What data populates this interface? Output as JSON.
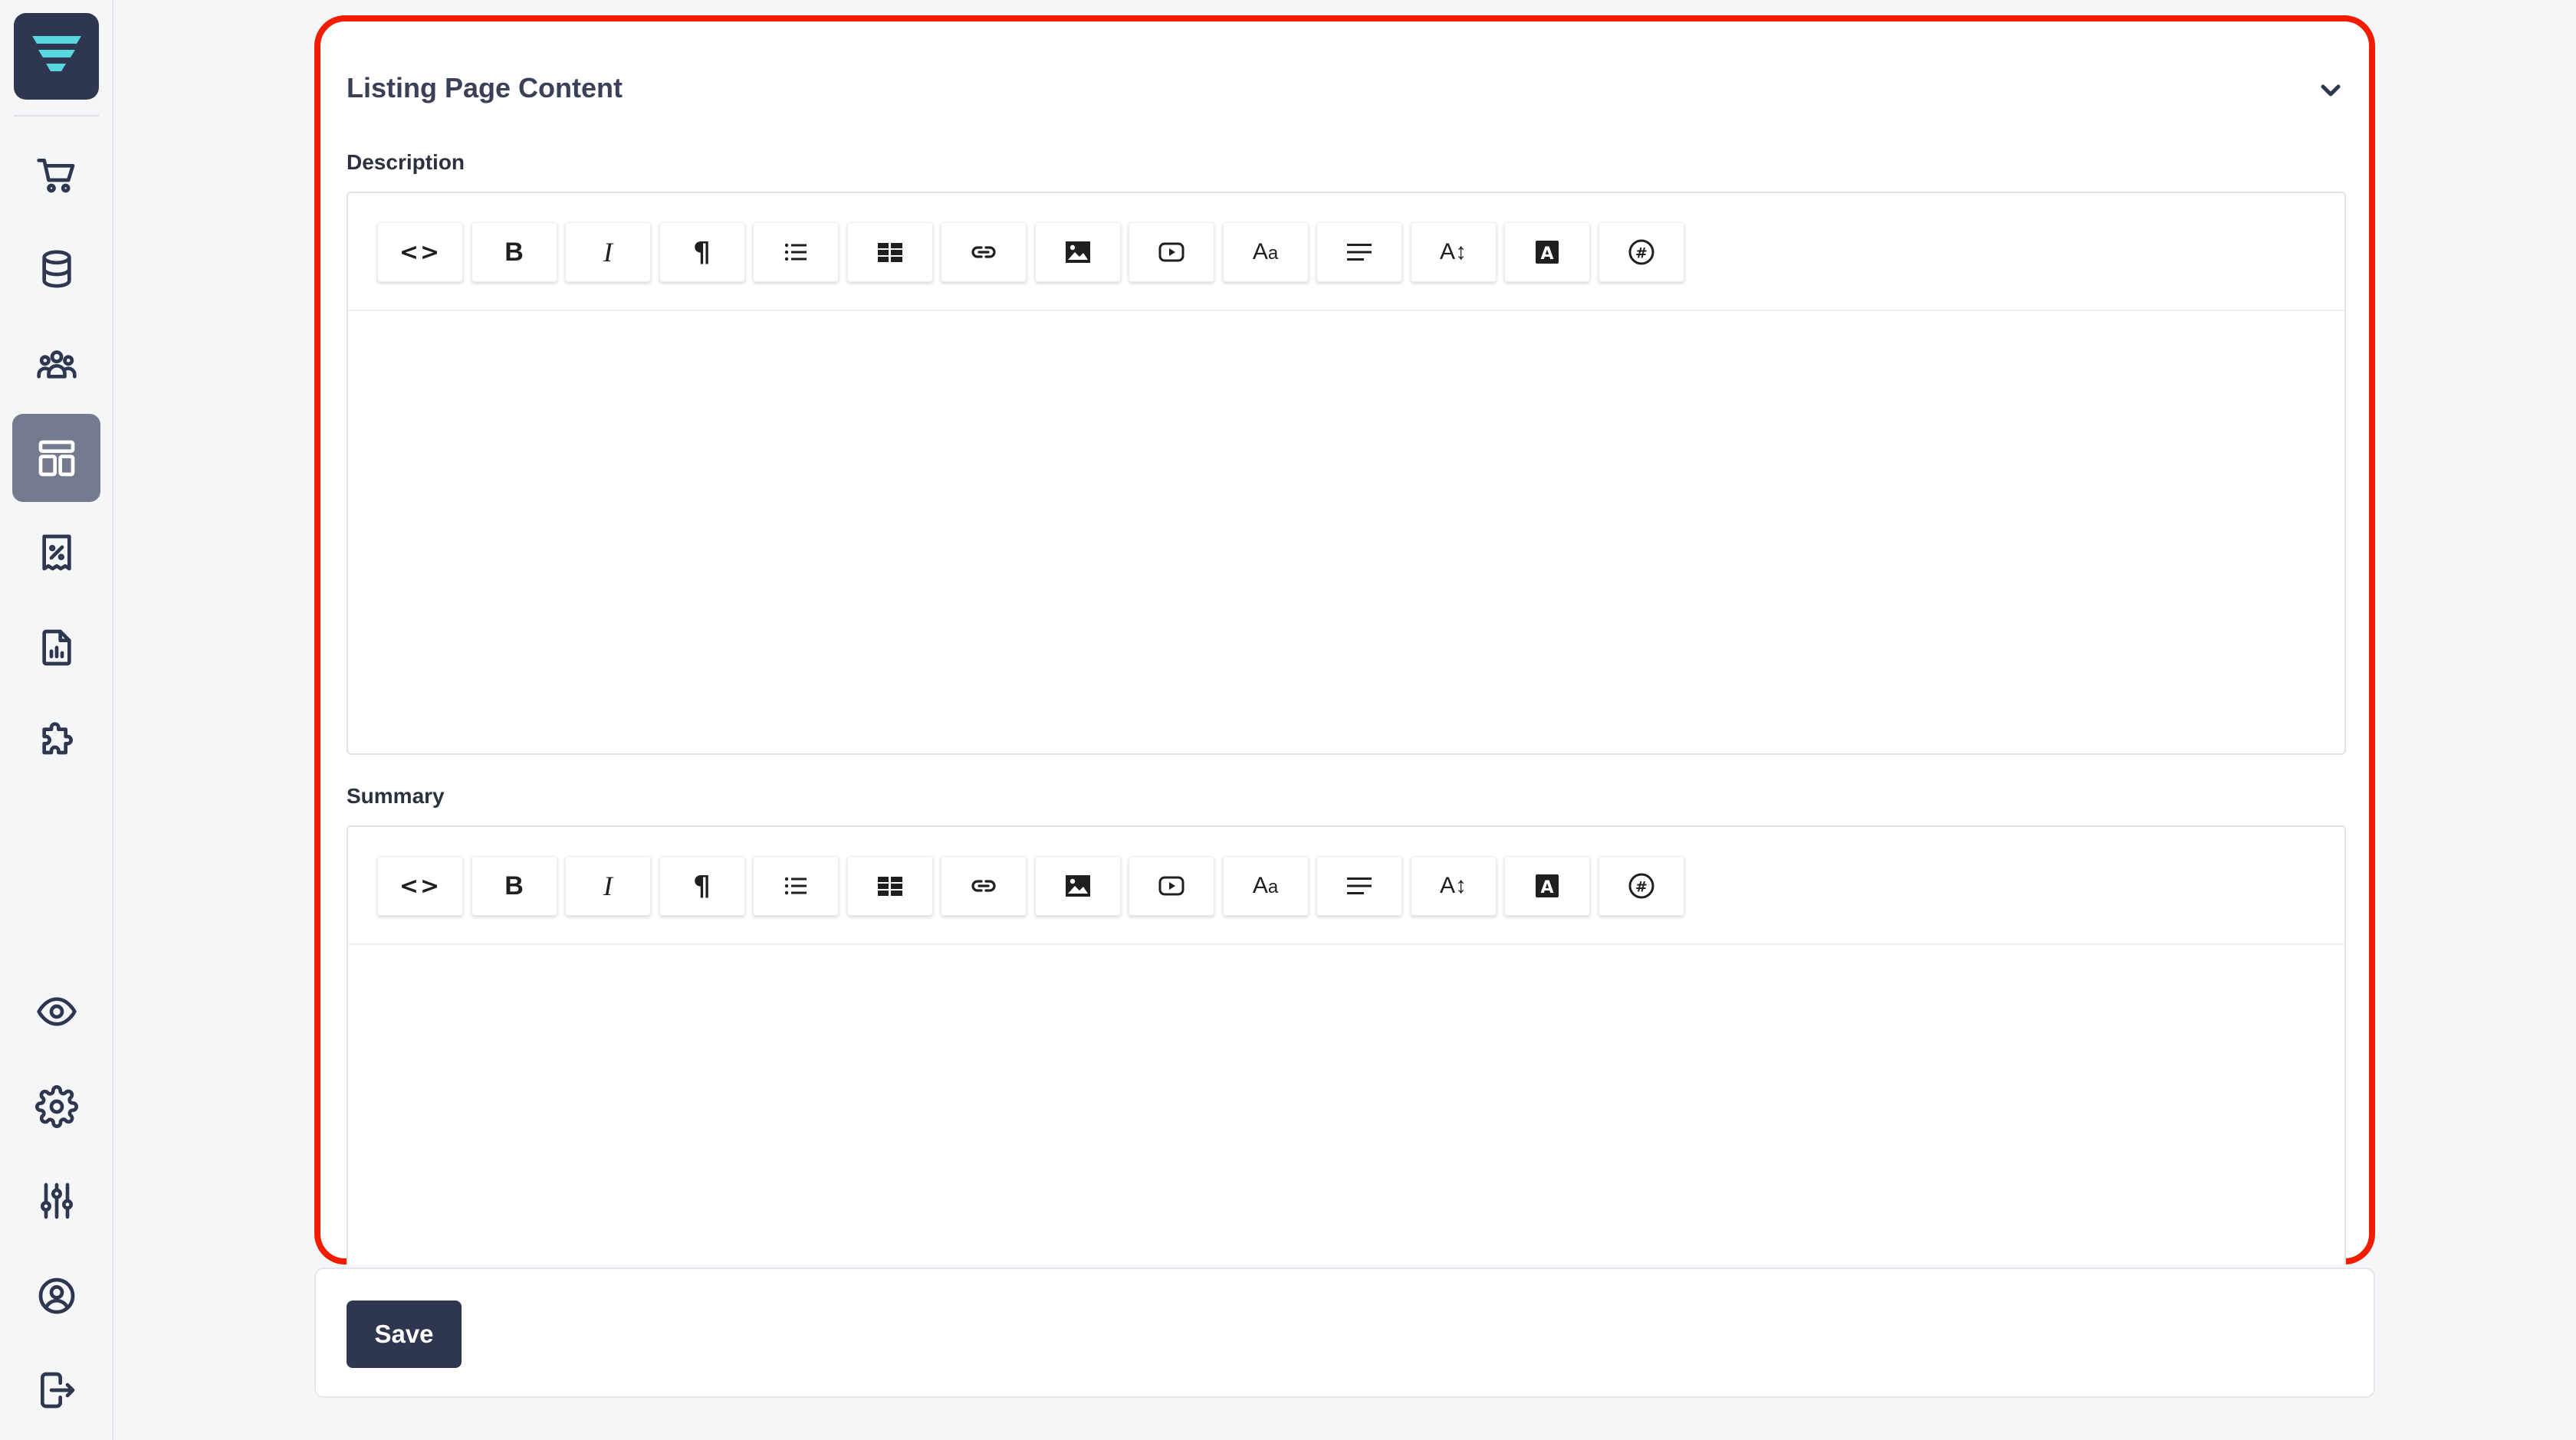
{
  "sidebar": {
    "logo": "brand-logo",
    "top_items": [
      {
        "name": "cart-icon",
        "active": false
      },
      {
        "name": "database-icon",
        "active": false
      },
      {
        "name": "users-group-icon",
        "active": false
      },
      {
        "name": "layout-icon",
        "active": true
      },
      {
        "name": "discount-receipt-icon",
        "active": false
      },
      {
        "name": "report-icon",
        "active": false
      },
      {
        "name": "puzzle-icon",
        "active": false
      }
    ],
    "bottom_items": [
      {
        "name": "eye-icon"
      },
      {
        "name": "gear-icon"
      },
      {
        "name": "sliders-icon"
      },
      {
        "name": "user-circle-icon"
      },
      {
        "name": "logout-icon"
      }
    ]
  },
  "section": {
    "title": "Listing Page Content",
    "collapse_icon": "chevron-down-icon",
    "accent_color": "#f21d00"
  },
  "editors": [
    {
      "label": "Description",
      "content": ""
    },
    {
      "label": "Summary",
      "content": ""
    }
  ],
  "toolbar": {
    "buttons": [
      {
        "name": "code-view",
        "icon": "code-icon",
        "text": "<>"
      },
      {
        "name": "bold",
        "icon": "bold-icon",
        "text": "B"
      },
      {
        "name": "italic",
        "icon": "italic-icon",
        "text": "I"
      },
      {
        "name": "paragraph",
        "icon": "paragraph-icon",
        "text": "¶"
      },
      {
        "name": "bullet-list",
        "icon": "list-icon",
        "text": ""
      },
      {
        "name": "table",
        "icon": "table-icon",
        "text": ""
      },
      {
        "name": "link",
        "icon": "link-icon",
        "text": ""
      },
      {
        "name": "image",
        "icon": "image-icon",
        "text": ""
      },
      {
        "name": "video",
        "icon": "video-icon",
        "text": ""
      },
      {
        "name": "font-size",
        "icon": "font-icon",
        "text": "Aa"
      },
      {
        "name": "align",
        "icon": "align-icon",
        "text": ""
      },
      {
        "name": "line-height",
        "icon": "line-height-icon",
        "text": "A↕"
      },
      {
        "name": "text-color",
        "icon": "text-color-icon",
        "text": "A"
      },
      {
        "name": "special-chars",
        "icon": "hash-icon",
        "text": "#"
      }
    ]
  },
  "actions": {
    "save_label": "Save",
    "save_color": "#2f3650"
  }
}
